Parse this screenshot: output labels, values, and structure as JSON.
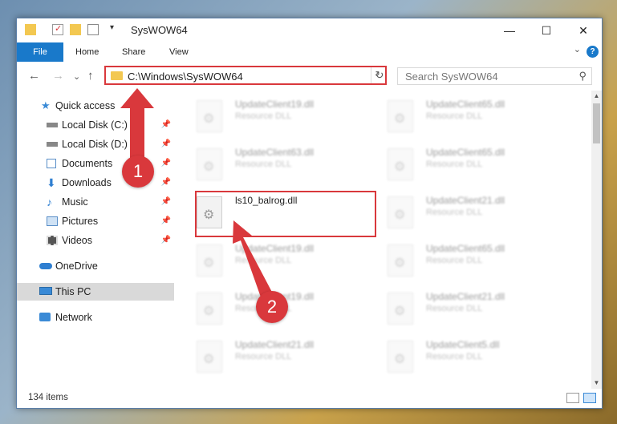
{
  "window": {
    "title": "SysWOW64",
    "minimize_glyph": "—",
    "maximize_glyph": "☐",
    "close_glyph": "✕"
  },
  "ribbon": {
    "tabs": [
      "File",
      "Home",
      "Share",
      "View"
    ],
    "collapse_glyph": "⌄",
    "help_glyph": "?"
  },
  "nav": {
    "back_glyph": "←",
    "forward_glyph": "→",
    "recent_glyph": "⌄",
    "up_glyph": "↑",
    "address": "C:\\Windows\\SysWOW64",
    "dropdown_glyph": "⌄",
    "refresh_glyph": "↻",
    "search_placeholder": "Search SysWOW64",
    "search_glyph": "⚲"
  },
  "sidebar": {
    "pin_glyph": "📌",
    "items": [
      {
        "label": "Quick access",
        "icon": "star-icon",
        "color": "#3a8ad6"
      },
      {
        "label": "Local Disk (C:)",
        "icon": "drive-icon",
        "color": "#888888"
      },
      {
        "label": "Local Disk (D:)",
        "icon": "drive-icon",
        "color": "#888888"
      },
      {
        "label": "Documents",
        "icon": "documents-icon",
        "color": "#5a8fc8"
      },
      {
        "label": "Downloads",
        "icon": "downloads-icon",
        "color": "#2f7fd1"
      },
      {
        "label": "Music",
        "icon": "music-icon",
        "color": "#2f7fd1"
      },
      {
        "label": "Pictures",
        "icon": "pictures-icon",
        "color": "#5a8fc8"
      },
      {
        "label": "Videos",
        "icon": "videos-icon",
        "color": "#555555"
      },
      {
        "label": "OneDrive",
        "icon": "cloud-icon",
        "color": "#2f7fd1"
      },
      {
        "label": "This PC",
        "icon": "computer-icon",
        "color": "#3a8ad6"
      },
      {
        "label": "Network",
        "icon": "network-icon",
        "color": "#3a8ad6"
      }
    ]
  },
  "files": [
    {
      "name": "UpdateClient19.dll",
      "type": "Resource DLL"
    },
    {
      "name": "UpdateClient65.dll",
      "type": "Resource DLL"
    },
    {
      "name": "UpdateClient63.dll",
      "type": "Resource DLL"
    },
    {
      "name": "UpdateClient65.dll",
      "type": "Resource DLL"
    },
    {
      "name": "ls10_balrog.dll",
      "type": ""
    },
    {
      "name": "UpdateClient21.dll",
      "type": "Resource DLL"
    },
    {
      "name": "UpdateClient19.dll",
      "type": "Resource DLL"
    },
    {
      "name": "UpdateClient65.dll",
      "type": "Resource DLL"
    },
    {
      "name": "UpdateClient19.dll",
      "type": "Resource DLL"
    },
    {
      "name": "UpdateClient21.dll",
      "type": "Resource DLL"
    },
    {
      "name": "UpdateClient21.dll",
      "type": "Resource DLL"
    },
    {
      "name": "UpdateClient5.dll",
      "type": "Resource DLL"
    }
  ],
  "status": {
    "items_count": "134 items"
  },
  "annotations": {
    "step1": "1",
    "step2": "2",
    "color": "#d9383c"
  }
}
